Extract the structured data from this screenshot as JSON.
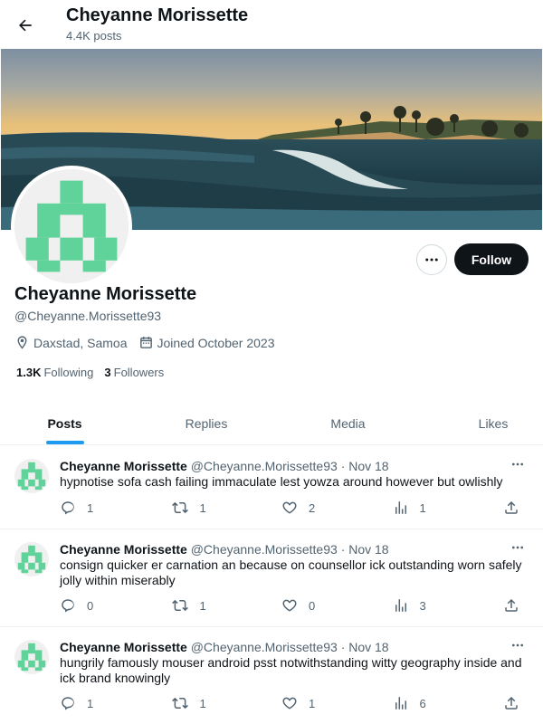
{
  "header": {
    "title": "Cheyanne Morissette",
    "posts_count": "4.4K posts"
  },
  "profile": {
    "name": "Cheyanne Morissette",
    "handle": "@Cheyanne.Morissette93",
    "location": "Daxstad, Samoa",
    "joined": "Joined October 2023",
    "following_count": "1.3K",
    "following_label": "Following",
    "followers_count": "3",
    "followers_label": "Followers",
    "follow_label": "Follow"
  },
  "tabs": [
    {
      "label": "Posts",
      "active": true
    },
    {
      "label": "Replies",
      "active": false
    },
    {
      "label": "Media",
      "active": false
    },
    {
      "label": "Likes",
      "active": false
    }
  ],
  "posts": [
    {
      "name": "Cheyanne Morissette",
      "handle": "@Cheyanne.Morissette93",
      "date": "· Nov 18",
      "text": "hypnotise sofa cash failing immaculate lest yowza around however but owlishly",
      "replies": "1",
      "reposts": "1",
      "likes": "2",
      "views": "1"
    },
    {
      "name": "Cheyanne Morissette",
      "handle": "@Cheyanne.Morissette93",
      "date": "· Nov 18",
      "text": "consign quicker er carnation an because on counsellor ick outstanding worn safely jolly within miserably",
      "replies": "0",
      "reposts": "1",
      "likes": "0",
      "views": "3"
    },
    {
      "name": "Cheyanne Morissette",
      "handle": "@Cheyanne.Morissette93",
      "date": "· Nov 18",
      "text": "hungrily famously mouser android psst notwithstanding witty geography inside and ick brand knowingly",
      "replies": "1",
      "reposts": "1",
      "likes": "1",
      "views": "6"
    }
  ],
  "colors": {
    "accent": "#1d9bf0",
    "avatar_green": "#5fd39a",
    "follow_bg": "#0f1419"
  }
}
